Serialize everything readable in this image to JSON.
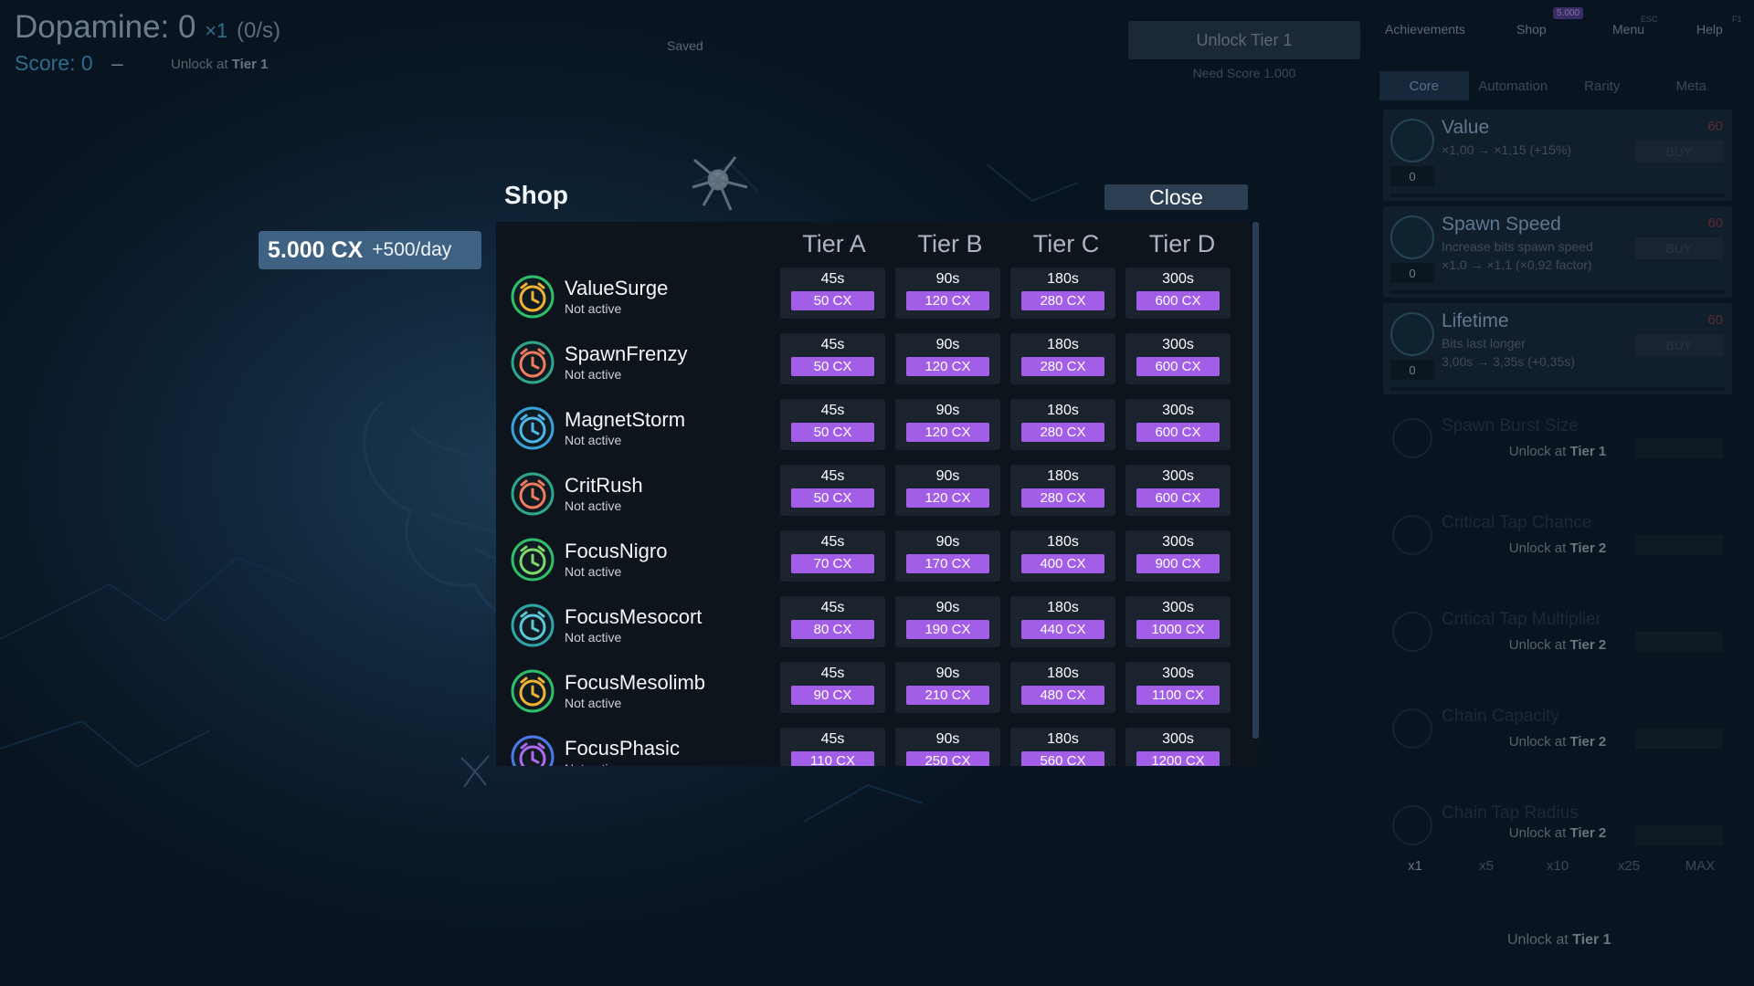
{
  "hud": {
    "dopamine": "Dopamine: 0",
    "multiplier": "×1",
    "rate": "(0/s)",
    "score": "Score: 0",
    "score_dash": "–",
    "unlock_prefix": "Unlock at ",
    "unlock_tier": "Tier 1",
    "saved": "Saved",
    "unlock_button": "Unlock Tier 1",
    "need_score": "Need Score 1.000"
  },
  "nav": {
    "achievements": "Achievements",
    "shop": "Shop",
    "shop_badge": "5.000",
    "menu": "Menu",
    "menu_hotkey": "ESC",
    "help": "Help",
    "help_hotkey": "F1"
  },
  "panel": {
    "tabs": [
      "Core",
      "Automation",
      "Rarity",
      "Meta"
    ],
    "active_tab": "Core",
    "upgrades": [
      {
        "name": "Value",
        "desc1": "×1,00 → ×1,15 (+15%)",
        "desc2": "",
        "cost": "60",
        "count": "0",
        "buy": "BUY"
      },
      {
        "name": "Spawn Speed",
        "desc1": "Increase bits spawn speed",
        "desc2": "×1,0 → ×1,1 (×0,92 factor)",
        "cost": "60",
        "count": "0",
        "buy": "BUY"
      },
      {
        "name": "Lifetime",
        "desc1": "Bits last longer",
        "desc2": "3,00s → 3,35s (+0,35s)",
        "cost": "60",
        "count": "0",
        "buy": "BUY"
      }
    ],
    "locked": [
      {
        "ghost": "Spawn Burst Size",
        "prefix": "Unlock at ",
        "tier": "Tier 1"
      },
      {
        "ghost": "Critical Tap Chance",
        "prefix": "Unlock at ",
        "tier": "Tier 2"
      },
      {
        "ghost": "Critical Tap Multiplier",
        "prefix": "Unlock at ",
        "tier": "Tier 2"
      },
      {
        "ghost": "Chain Capacity",
        "prefix": "Unlock at ",
        "tier": "Tier 2"
      },
      {
        "ghost": "Chain Tap Radius",
        "prefix": "Unlock at ",
        "tier": "Tier 2"
      }
    ],
    "buy_multipliers": [
      "x1",
      "x5",
      "x10",
      "x25",
      "MAX"
    ],
    "active_multiplier": "x1",
    "bottom_unlock_prefix": "Unlock at ",
    "bottom_unlock_tier": "Tier 1"
  },
  "currency": {
    "amount": "5.000 CX",
    "per_day": "+500/day"
  },
  "shop": {
    "title": "Shop",
    "close": "Close",
    "tiers": [
      "Tier A",
      "Tier B",
      "Tier C",
      "Tier D"
    ],
    "durations": [
      "45s",
      "90s",
      "180s",
      "300s"
    ],
    "status_default": "Not active",
    "items": [
      {
        "name": "ValueSurge",
        "status": "Not active",
        "color": "#f2b233",
        "ring": "#2fbf6a",
        "prices": [
          "50 CX",
          "120 CX",
          "280 CX",
          "600 CX"
        ]
      },
      {
        "name": "SpawnFrenzy",
        "status": "Not active",
        "color": "#f27d5e",
        "ring": "#2fa58a",
        "prices": [
          "50 CX",
          "120 CX",
          "280 CX",
          "600 CX"
        ]
      },
      {
        "name": "MagnetStorm",
        "status": "Not active",
        "color": "#4fb8e8",
        "ring": "#3aa0d8",
        "prices": [
          "50 CX",
          "120 CX",
          "280 CX",
          "600 CX"
        ]
      },
      {
        "name": "CritRush",
        "status": "Not active",
        "color": "#f27d5e",
        "ring": "#2fa58a",
        "prices": [
          "50 CX",
          "120 CX",
          "280 CX",
          "600 CX"
        ]
      },
      {
        "name": "FocusNigro",
        "status": "Not active",
        "color": "#7fd96a",
        "ring": "#2fbf6a",
        "prices": [
          "70 CX",
          "170 CX",
          "400 CX",
          "900 CX"
        ]
      },
      {
        "name": "FocusMesocort",
        "status": "Not active",
        "color": "#5fc8d8",
        "ring": "#2fa5a8",
        "prices": [
          "80 CX",
          "190 CX",
          "440 CX",
          "1000 CX"
        ]
      },
      {
        "name": "FocusMesolimb",
        "status": "Not active",
        "color": "#f2b233",
        "ring": "#2fbf6a",
        "prices": [
          "90 CX",
          "210 CX",
          "480 CX",
          "1100 CX"
        ]
      },
      {
        "name": "FocusPhasic",
        "status": "Not active",
        "color": "#b06af0",
        "ring": "#4a7ae8",
        "prices": [
          "110 CX",
          "250 CX",
          "560 CX",
          "1200 CX"
        ]
      }
    ]
  }
}
